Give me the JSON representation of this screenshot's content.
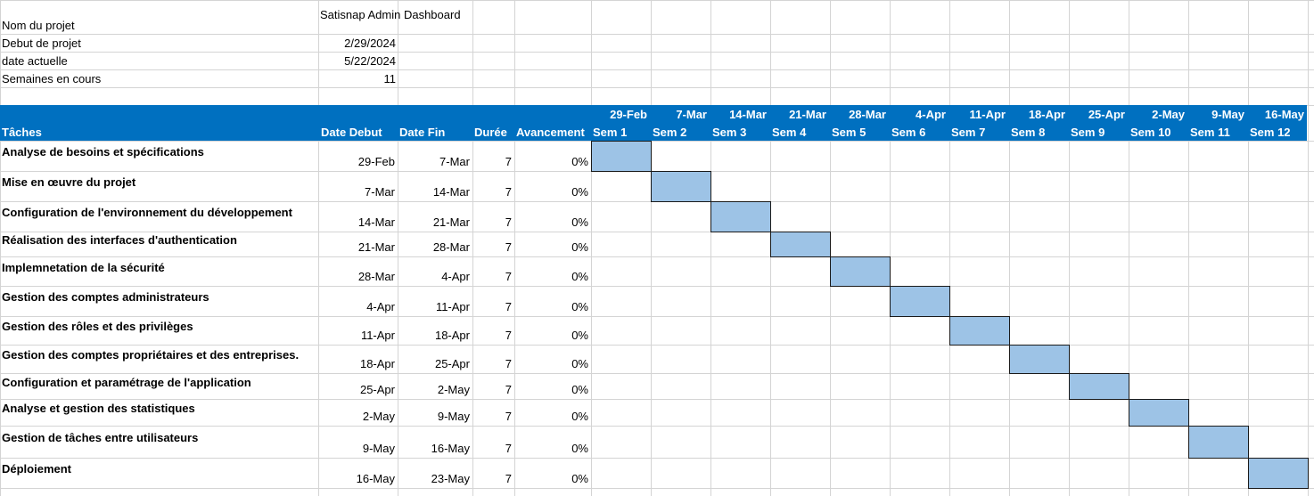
{
  "project_info": {
    "name_label": "Nom du projet",
    "name_value": "Satisnap Admin Dashboard",
    "start_label": "Debut de projet",
    "start_value": "2/29/2024",
    "current_label": "date actuelle",
    "current_value": "5/22/2024",
    "weeks_label": "Semaines en cours",
    "weeks_value": "11"
  },
  "table_header": {
    "task": "Tâches",
    "start": "Date Debut",
    "end": "Date Fin",
    "duration": "Durée",
    "progress": "Avancement"
  },
  "weeks": [
    {
      "date": "29-Feb",
      "label": "Sem 1"
    },
    {
      "date": "7-Mar",
      "label": "Sem 2"
    },
    {
      "date": "14-Mar",
      "label": "Sem 3"
    },
    {
      "date": "21-Mar",
      "label": "Sem 4"
    },
    {
      "date": "28-Mar",
      "label": "Sem 5"
    },
    {
      "date": "4-Apr",
      "label": "Sem 6"
    },
    {
      "date": "11-Apr",
      "label": "Sem 7"
    },
    {
      "date": "18-Apr",
      "label": "Sem 8"
    },
    {
      "date": "25-Apr",
      "label": "Sem 9"
    },
    {
      "date": "2-May",
      "label": "Sem 10"
    },
    {
      "date": "9-May",
      "label": "Sem 11"
    },
    {
      "date": "16-May",
      "label": "Sem 12"
    }
  ],
  "tasks": [
    {
      "name": "Analyse de besoins et spécifications",
      "start": "29-Feb",
      "end": "7-Mar",
      "duration": "7",
      "progress": "0%",
      "week": 1
    },
    {
      "name": "Mise en œuvre du projet",
      "start": "7-Mar",
      "end": "14-Mar",
      "duration": "7",
      "progress": "0%",
      "week": 2
    },
    {
      "name": "Configuration de l'environnement du développement",
      "start": "14-Mar",
      "end": "21-Mar",
      "duration": "7",
      "progress": "0%",
      "week": 3
    },
    {
      "name": "Réalisation des interfaces d'authentication",
      "start": "21-Mar",
      "end": "28-Mar",
      "duration": "7",
      "progress": "0%",
      "week": 4
    },
    {
      "name": "Implemnetation de la sécurité",
      "start": "28-Mar",
      "end": "4-Apr",
      "duration": "7",
      "progress": "0%",
      "week": 5
    },
    {
      "name": "Gestion des comptes administrateurs",
      "start": "4-Apr",
      "end": "11-Apr",
      "duration": "7",
      "progress": "0%",
      "week": 6
    },
    {
      "name": "Gestion des rôles et des privilèges",
      "start": "11-Apr",
      "end": "18-Apr",
      "duration": "7",
      "progress": "0%",
      "week": 7
    },
    {
      "name": "Gestion des comptes propriétaires et des entreprises.",
      "start": "18-Apr",
      "end": "25-Apr",
      "duration": "7",
      "progress": "0%",
      "week": 8
    },
    {
      "name": "Configuration et paramétrage de l'application",
      "start": "25-Apr",
      "end": "2-May",
      "duration": "7",
      "progress": "0%",
      "week": 9
    },
    {
      "name": "Analyse et gestion des statistiques",
      "start": "2-May",
      "end": "9-May",
      "duration": "7",
      "progress": "0%",
      "week": 10
    },
    {
      "name": "Gestion de tâches entre utilisateurs",
      "start": "9-May",
      "end": "16-May",
      "duration": "7",
      "progress": "0%",
      "week": 11
    },
    {
      "name": "Déploiement",
      "start": "16-May",
      "end": "23-May",
      "duration": "7",
      "progress": "0%",
      "week": 12
    }
  ],
  "colors": {
    "header_band": "#0070c0",
    "gantt_bar": "#9dc3e6",
    "gridline": "#d4d4d4"
  }
}
